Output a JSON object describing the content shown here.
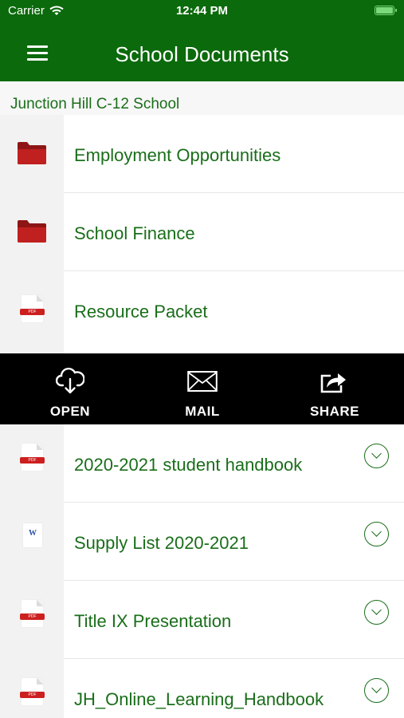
{
  "status_bar": {
    "carrier": "Carrier",
    "time": "12:44 PM",
    "wifi_icon": "wifi-icon",
    "battery_icon": "battery-icon"
  },
  "header": {
    "title": "School Documents",
    "menu_icon": "hamburger-menu-icon",
    "background": "#0b6a0b"
  },
  "school_name": "Junction Hill C-12 School",
  "documents": [
    {
      "label": "Employment Opportunities",
      "icon": "folder-icon"
    },
    {
      "label": "School Finance",
      "icon": "folder-icon"
    },
    {
      "label": "Resource Packet",
      "icon": "pdf-file-icon"
    },
    {
      "label": "2020-2021 student handbook",
      "icon": "pdf-file-icon"
    },
    {
      "label": "Supply List 2020-2021",
      "icon": "word-file-icon"
    },
    {
      "label": "Title IX Presentation",
      "icon": "pdf-file-icon"
    },
    {
      "label": "JH_Online_Learning_Handbook",
      "icon": "pdf-file-icon"
    }
  ],
  "file_icon_tags": {
    "pdf": "PDF",
    "word": "W"
  },
  "actions": [
    {
      "label": "OPEN",
      "icon": "cloud-download-icon"
    },
    {
      "label": "MAIL",
      "icon": "envelope-icon"
    },
    {
      "label": "SHARE",
      "icon": "share-icon"
    }
  ],
  "colors": {
    "accent_green": "#1a6e1a",
    "folder_red": "#c0201f",
    "pdf_red": "#cc1f1f",
    "action_bar": "#000000"
  }
}
